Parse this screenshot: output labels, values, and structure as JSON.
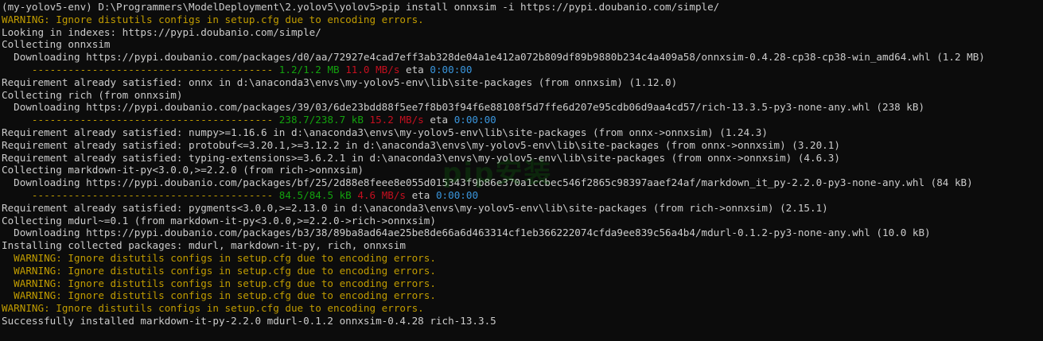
{
  "colors": {
    "background": "#0c0c0c",
    "default_text": "#cccccc",
    "warning": "#c19c00",
    "progress_bar": "#c19c00",
    "progress_size": "#13a10e",
    "progress_speed": "#c50f1f",
    "progress_eta": "#3a96dd"
  },
  "lines": [
    {
      "segs": [
        {
          "t": "(my-yolov5-env) D:\\Programmers\\ModelDeployment\\2.yolov5\\yolov5>pip install onnxsim -i https://pypi.doubanio.com/simple/",
          "c": "default"
        }
      ]
    },
    {
      "segs": [
        {
          "t": "WARNING: Ignore distutils configs in setup.cfg due to encoding errors.",
          "c": "yellow"
        }
      ]
    },
    {
      "segs": [
        {
          "t": "Looking in indexes: https://pypi.doubanio.com/simple/",
          "c": "default"
        }
      ]
    },
    {
      "segs": [
        {
          "t": "Collecting onnxsim",
          "c": "default"
        }
      ]
    },
    {
      "segs": [
        {
          "t": "  Downloading https://pypi.doubanio.com/packages/d0/aa/72927e4cad7eff3ab328de04a1e412a072b809df89b9880b234c4a409a58/onnxsim-0.4.28-cp38-cp38-win_amd64.whl (1.2 MB)",
          "c": "default"
        }
      ]
    },
    {
      "segs": [
        {
          "t": "     ---------------------------------------- ",
          "c": "yellow"
        },
        {
          "t": "1.2/1.2 MB ",
          "c": "green"
        },
        {
          "t": "11.0 MB/s",
          "c": "red"
        },
        {
          "t": " eta ",
          "c": "default"
        },
        {
          "t": "0:00:00",
          "c": "cyan"
        }
      ]
    },
    {
      "segs": [
        {
          "t": "Requirement already satisfied: onnx in d:\\anaconda3\\envs\\my-yolov5-env\\lib\\site-packages (from onnxsim) (1.12.0)",
          "c": "default"
        }
      ]
    },
    {
      "segs": [
        {
          "t": "Collecting rich (from onnxsim)",
          "c": "default"
        }
      ]
    },
    {
      "segs": [
        {
          "t": "  Downloading https://pypi.doubanio.com/packages/39/03/6de23bdd88f5ee7f8b03f94f6e88108f5d7ffe6d207e95cdb06d9aa4cd57/rich-13.3.5-py3-none-any.whl (238 kB)",
          "c": "default"
        }
      ]
    },
    {
      "segs": [
        {
          "t": "     ---------------------------------------- ",
          "c": "yellow"
        },
        {
          "t": "238.7/238.7 kB ",
          "c": "green"
        },
        {
          "t": "15.2 MB/s",
          "c": "red"
        },
        {
          "t": " eta ",
          "c": "default"
        },
        {
          "t": "0:00:00",
          "c": "cyan"
        }
      ]
    },
    {
      "segs": [
        {
          "t": "Requirement already satisfied: numpy>=1.16.6 in d:\\anaconda3\\envs\\my-yolov5-env\\lib\\site-packages (from onnx->onnxsim) (1.24.3)",
          "c": "default"
        }
      ]
    },
    {
      "segs": [
        {
          "t": "Requirement already satisfied: protobuf<=3.20.1,>=3.12.2 in d:\\anaconda3\\envs\\my-yolov5-env\\lib\\site-packages (from onnx->onnxsim) (3.20.1)",
          "c": "default"
        }
      ]
    },
    {
      "segs": [
        {
          "t": "Requirement already satisfied: typing-extensions>=3.6.2.1 in d:\\anaconda3\\envs\\my-yolov5-env\\lib\\site-packages (from onnx->onnxsim) (4.6.3)",
          "c": "default"
        }
      ]
    },
    {
      "segs": [
        {
          "t": "Collecting markdown-it-py<3.0.0,>=2.2.0 (from rich->onnxsim)",
          "c": "default"
        }
      ]
    },
    {
      "segs": [
        {
          "t": "  Downloading https://pypi.doubanio.com/packages/bf/25/2d88e8feee8e055d015343f9b86e370a1ccbec546f2865c98397aaef24af/markdown_it_py-2.2.0-py3-none-any.whl (84 kB)",
          "c": "default"
        }
      ]
    },
    {
      "segs": [
        {
          "t": "     ---------------------------------------- ",
          "c": "yellow"
        },
        {
          "t": "84.5/84.5 kB ",
          "c": "green"
        },
        {
          "t": "4.6 MB/s",
          "c": "red"
        },
        {
          "t": " eta ",
          "c": "default"
        },
        {
          "t": "0:00:00",
          "c": "cyan"
        }
      ]
    },
    {
      "segs": [
        {
          "t": "Requirement already satisfied: pygments<3.0.0,>=2.13.0 in d:\\anaconda3\\envs\\my-yolov5-env\\lib\\site-packages (from rich->onnxsim) (2.15.1)",
          "c": "default"
        }
      ]
    },
    {
      "segs": [
        {
          "t": "Collecting mdurl~=0.1 (from markdown-it-py<3.0.0,>=2.2.0->rich->onnxsim)",
          "c": "default"
        }
      ]
    },
    {
      "segs": [
        {
          "t": "  Downloading https://pypi.doubanio.com/packages/b3/38/89ba8ad64ae25be8de66a6d463314cf1eb366222074cfda9ee839c56a4b4/mdurl-0.1.2-py3-none-any.whl (10.0 kB)",
          "c": "default"
        }
      ]
    },
    {
      "segs": [
        {
          "t": "Installing collected packages: mdurl, markdown-it-py, rich, onnxsim",
          "c": "default"
        }
      ]
    },
    {
      "segs": [
        {
          "t": "  WARNING: Ignore distutils configs in setup.cfg due to encoding errors.",
          "c": "yellow"
        }
      ]
    },
    {
      "segs": [
        {
          "t": "  WARNING: Ignore distutils configs in setup.cfg due to encoding errors.",
          "c": "yellow"
        }
      ]
    },
    {
      "segs": [
        {
          "t": "  WARNING: Ignore distutils configs in setup.cfg due to encoding errors.",
          "c": "yellow"
        }
      ]
    },
    {
      "segs": [
        {
          "t": "  WARNING: Ignore distutils configs in setup.cfg due to encoding errors.",
          "c": "yellow"
        }
      ]
    },
    {
      "segs": [
        {
          "t": "WARNING: Ignore distutils configs in setup.cfg due to encoding errors.",
          "c": "yellow"
        }
      ]
    },
    {
      "segs": [
        {
          "t": "Successfully installed markdown-it-py-2.2.0 mdurl-0.1.2 onnxsim-0.4.28 rich-13.3.5",
          "c": "default"
        }
      ]
    }
  ]
}
